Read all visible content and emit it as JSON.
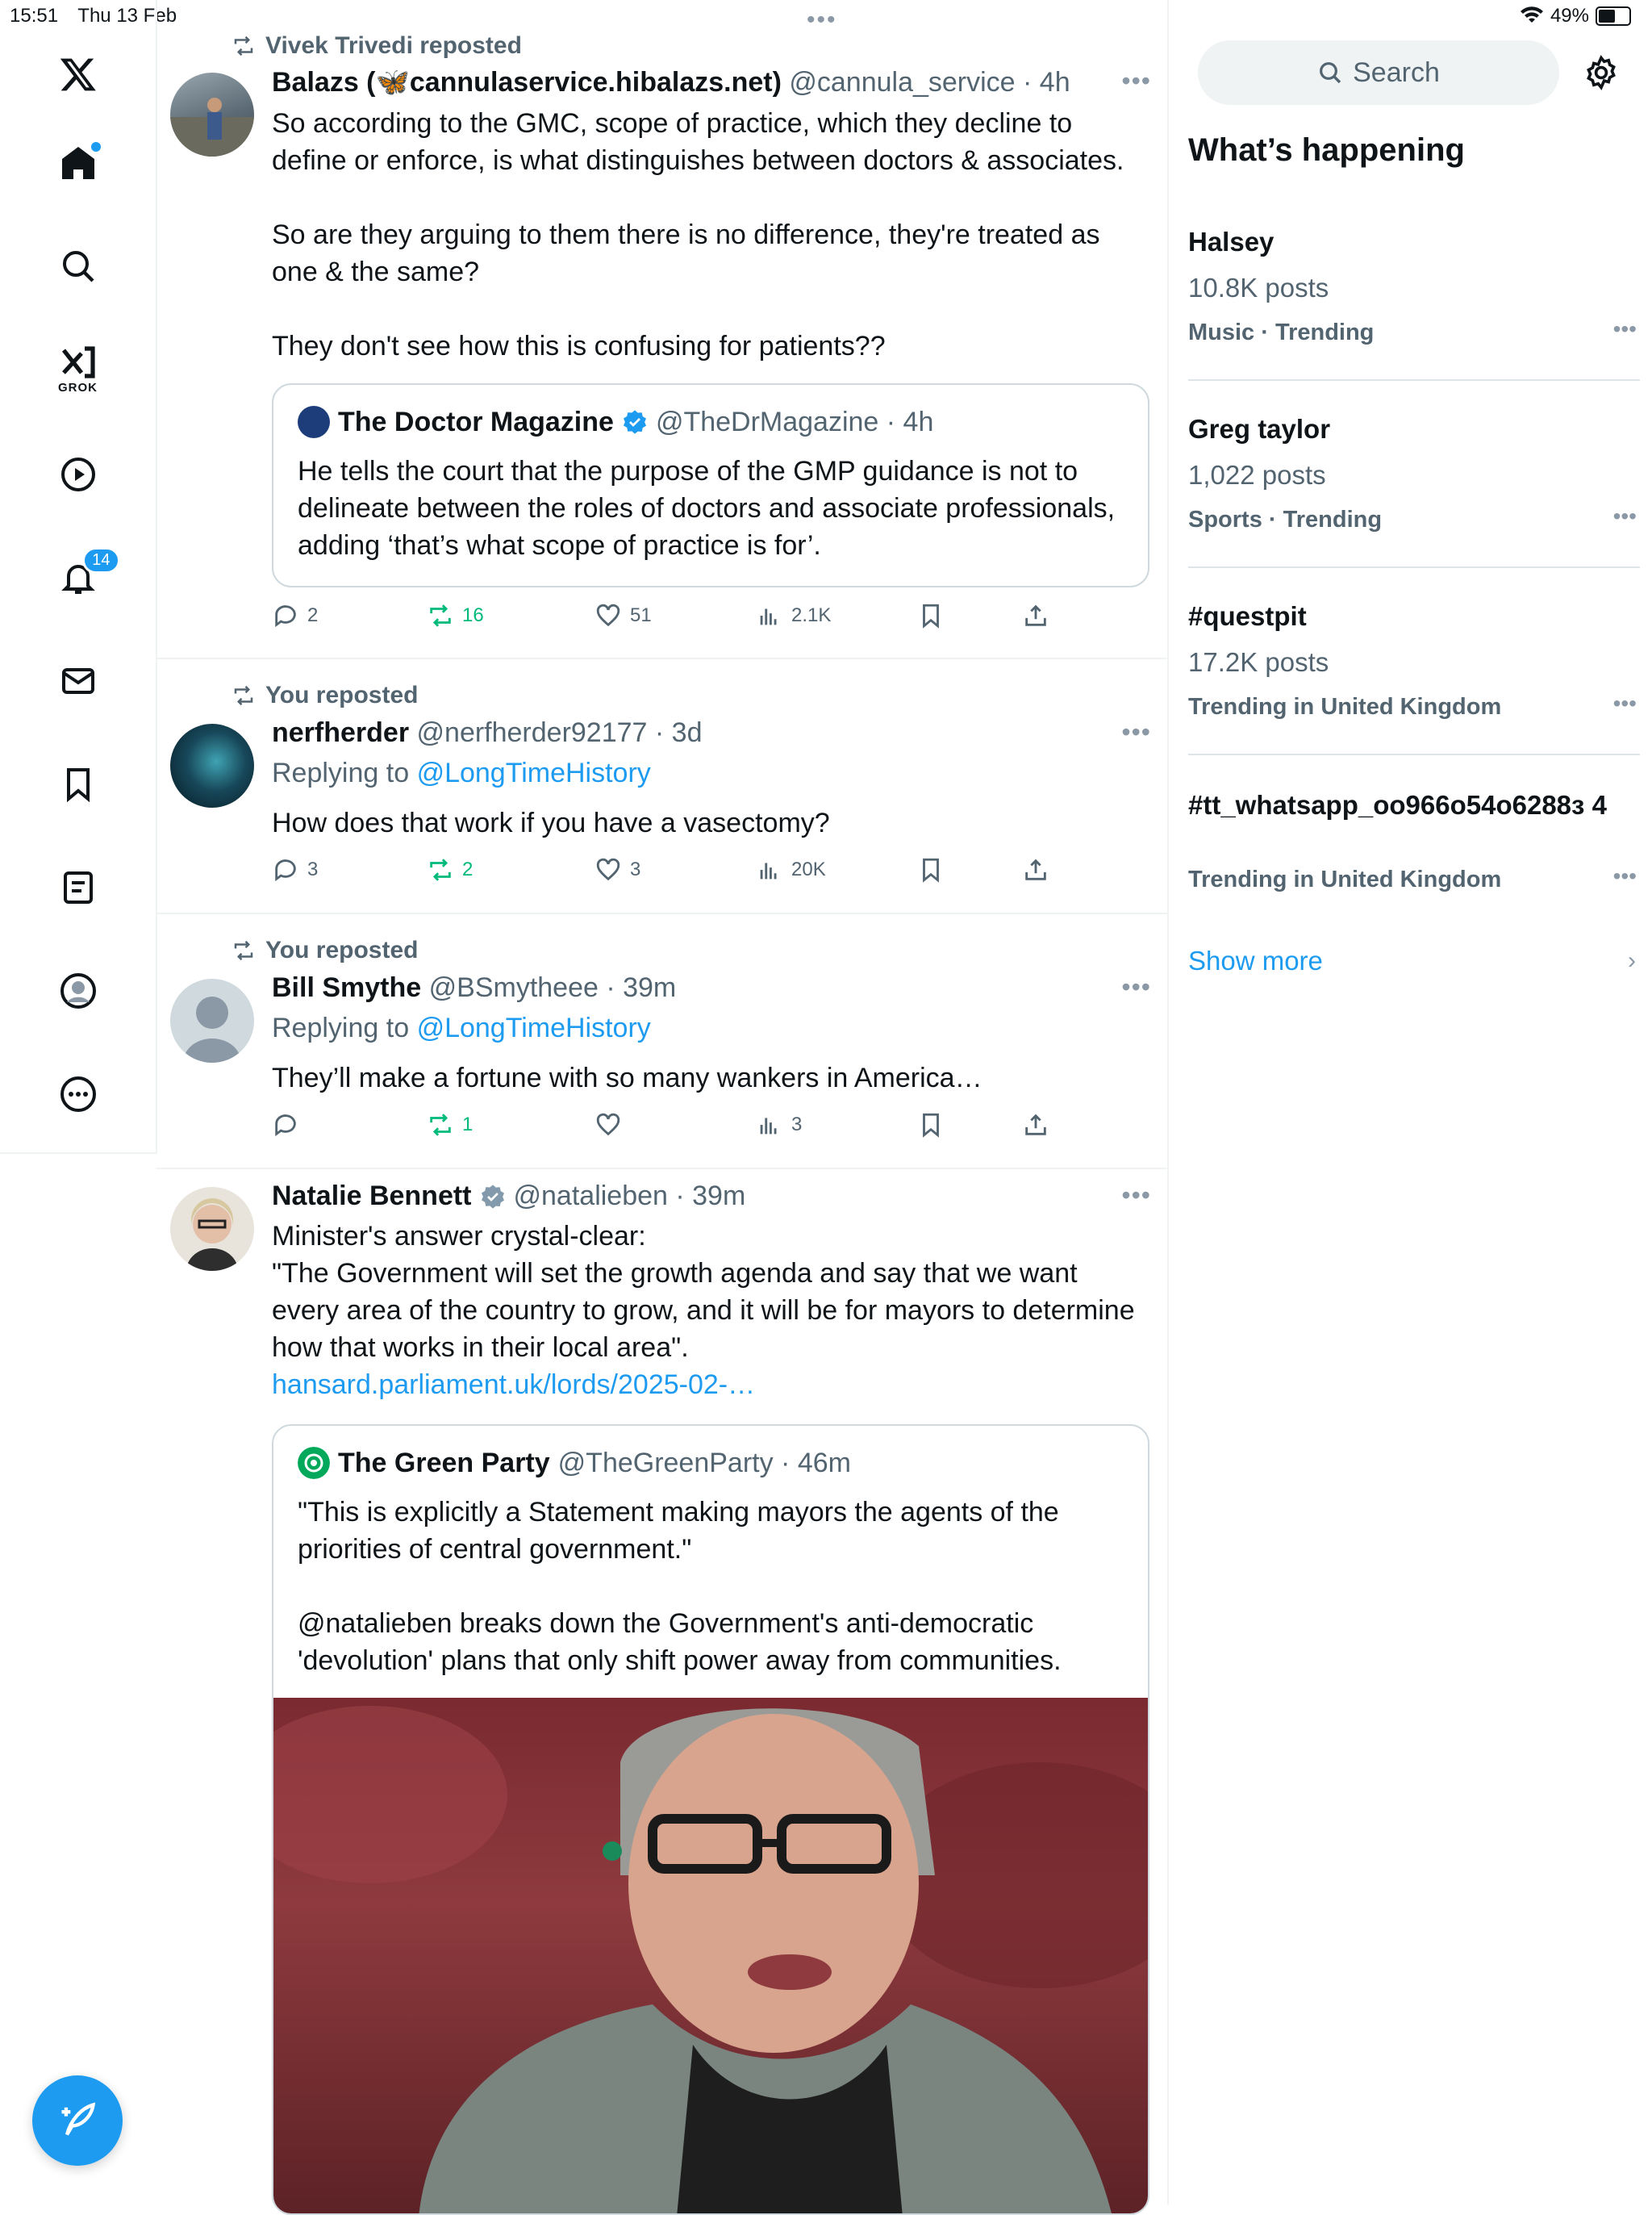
{
  "status": {
    "time": "15:51",
    "date": "Thu 13 Feb",
    "battery": "49%",
    "battery_level": 0.49
  },
  "nav": {
    "grok_label": "GROK",
    "notifications_count": "14"
  },
  "posts": [
    {
      "reposted_by": "Vivek Trivedi reposted",
      "name": "Balazs (🦋cannulaservice.hibalazs.net)",
      "meta": "@cannula_service · 4h",
      "text": "So according to the GMC, scope of practice, which they decline to define or enforce, is what distinguishes between doctors & associates.\n\nSo are they arguing to them there is no difference, they're treated as one & the same?\n\nThey don't see how this is confusing for patients??",
      "quote": {
        "name": "The Doctor Magazine",
        "meta": "@TheDrMagazine · 4h",
        "text": "He tells the court that the purpose of the GMP guidance is not to delineate between the roles of doctors and associate professionals, adding ‘that’s what scope of practice is for’."
      },
      "replies": "2",
      "reposts": "16",
      "likes": "51",
      "views": "2.1K"
    },
    {
      "reposted_by": "You reposted",
      "name": "nerfherder",
      "meta": "@nerfherder92177 · 3d",
      "replying_prefix": "Replying to",
      "replying_to": "@LongTimeHistory",
      "text": "How does that work if you have a vasectomy?",
      "replies": "3",
      "reposts": "2",
      "likes": "3",
      "views": "20K"
    },
    {
      "reposted_by": "You reposted",
      "name": "Bill Smythe",
      "meta": "@BSmytheee · 39m",
      "replying_prefix": "Replying to",
      "replying_to": "@LongTimeHistory",
      "text": "They’ll make a fortune with so many wankers in America…",
      "replies": "",
      "reposts": "1",
      "likes": "",
      "views": "3"
    },
    {
      "name": "Natalie Bennett",
      "meta": "@natalieben · 39m",
      "text": "Minister's answer crystal-clear:\n\"The Government will set the growth agenda and say that we want every area of the country to grow, and it will be for mayors to determine how that works in their local area\".",
      "link": "hansard.parliament.uk/lords/2025-02-…",
      "quote": {
        "name": "The Green Party",
        "meta": "@TheGreenParty · 46m",
        "text": "\"This is explicitly a Statement making mayors the agents of the priorities of central government.\"\n\n@natalieben breaks down the Government's anti-democratic 'devolution' plans that only shift power away from communities."
      }
    }
  ],
  "right": {
    "search_placeholder": "Search",
    "title": "What’s happening",
    "trends": [
      {
        "name": "Halsey",
        "count": "10.8K posts",
        "category": "Music · Trending"
      },
      {
        "name": "Greg taylor",
        "count": "1,022 posts",
        "category": "Sports · Trending"
      },
      {
        "name": "#questpit",
        "count": "17.2K posts",
        "category": "Trending in United Kingdom"
      },
      {
        "name": "#tt_whatsapp_oo966o54o6288з 4",
        "count": "",
        "category": "Trending in United Kingdom"
      }
    ],
    "show_more": "Show more"
  },
  "colors": {
    "accent": "#1d9bf0",
    "repost_green": "#00ba7c",
    "muted": "#536471"
  }
}
